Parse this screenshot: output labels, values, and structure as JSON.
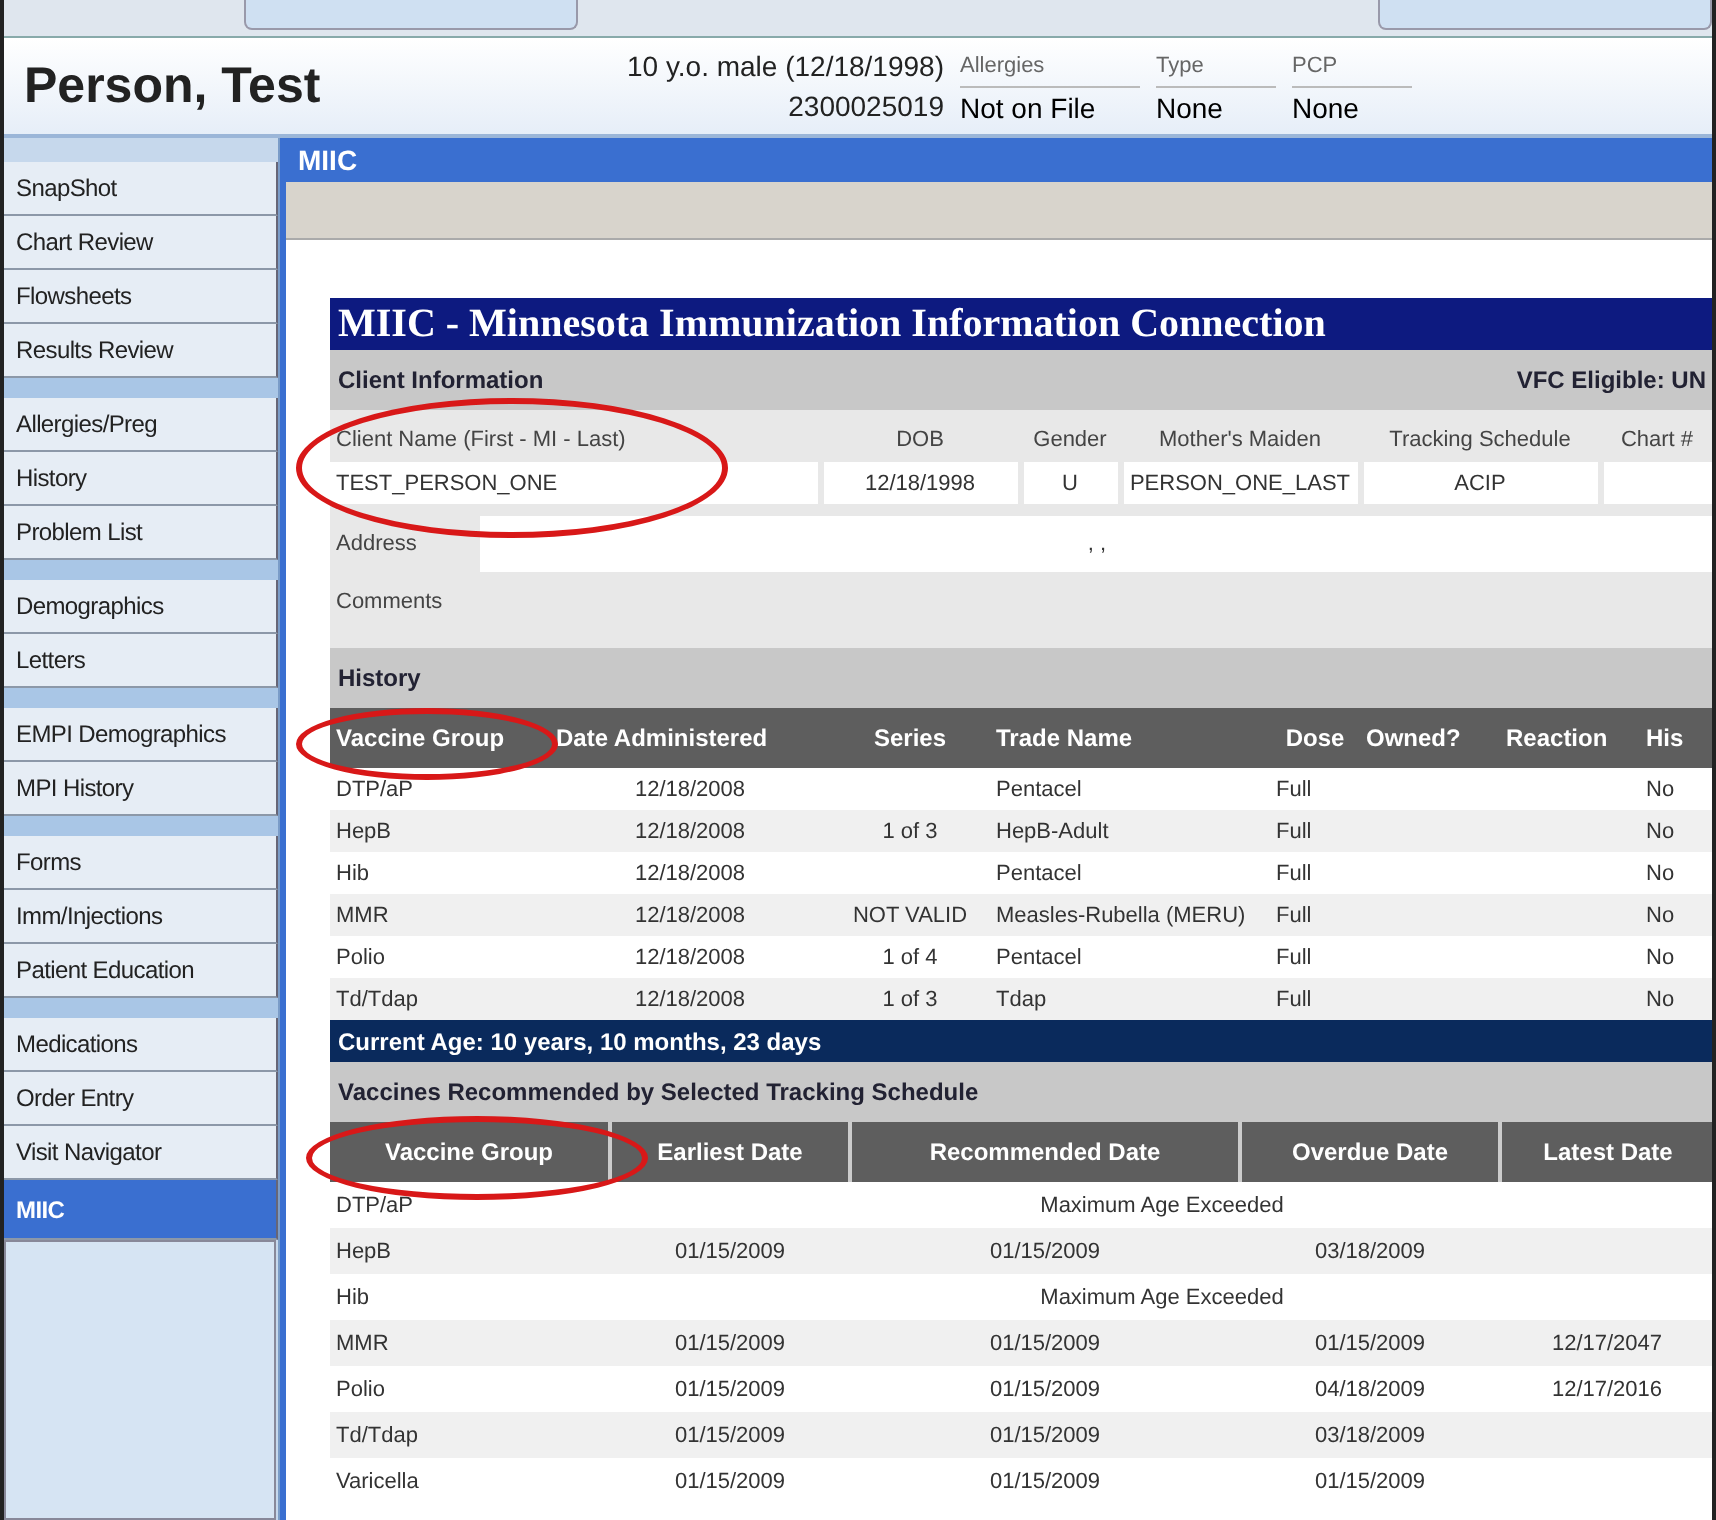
{
  "patient": {
    "name": "Person, Test",
    "age_sex_dob": "10 y.o. male (12/18/1998)",
    "mrn": "2300025019",
    "fields": [
      {
        "label": "Allergies",
        "value": "Not on File"
      },
      {
        "label": "Type",
        "value": "None"
      },
      {
        "label": "PCP",
        "value": "None"
      }
    ]
  },
  "sidebar": {
    "groups": [
      [
        {
          "label": "SnapShot",
          "selected": false
        },
        {
          "label": "Chart Review",
          "selected": false
        },
        {
          "label": "Flowsheets",
          "selected": false
        },
        {
          "label": "Results Review",
          "selected": false
        }
      ],
      [
        {
          "label": "Allergies/Preg",
          "selected": false
        },
        {
          "label": "History",
          "selected": false
        },
        {
          "label": "Problem List",
          "selected": false
        }
      ],
      [
        {
          "label": "Demographics",
          "selected": false
        },
        {
          "label": "Letters",
          "selected": false
        }
      ],
      [
        {
          "label": "EMPI Demographics",
          "selected": false
        },
        {
          "label": "MPI History",
          "selected": false
        }
      ],
      [
        {
          "label": "Forms",
          "selected": false
        },
        {
          "label": "Imm/Injections",
          "selected": false
        },
        {
          "label": "Patient Education",
          "selected": false
        }
      ],
      [
        {
          "label": "Medications",
          "selected": false
        },
        {
          "label": "Order Entry",
          "selected": false
        },
        {
          "label": "Visit Navigator",
          "selected": false
        },
        {
          "label": "MIIC",
          "selected": true
        }
      ]
    ]
  },
  "activity_title": "MIIC",
  "miic": {
    "title": "MIIC - Minnesota Immunization Information Connection",
    "client_info": {
      "heading": "Client Information",
      "vfc": "VFC Eligible: UN",
      "columns": [
        "Client Name (First - MI - Last)",
        "DOB",
        "Gender",
        "Mother's Maiden",
        "Tracking Schedule",
        "Chart #"
      ],
      "values": [
        "TEST_PERSON_ONE",
        "12/18/1998",
        "U",
        "PERSON_ONE_LAST",
        "ACIP"
      ],
      "address_label": "Address",
      "address_value": ", ,",
      "comments_label": "Comments"
    },
    "history": {
      "heading": "History",
      "columns": [
        "Vaccine Group",
        "Date Administered",
        "Series",
        "Trade Name",
        "Dose",
        "Owned?",
        "Reaction",
        "His"
      ],
      "rows": [
        {
          "group": "DTP/aP",
          "date": "12/18/2008",
          "trade": "Pentacel",
          "dose": "Full",
          "history": "No"
        },
        {
          "group": "HepB",
          "date": "12/18/2008",
          "series": "1 of 3",
          "trade": "HepB-Adult",
          "dose": "Full",
          "history": "No"
        },
        {
          "group": "Hib",
          "date": "12/18/2008",
          "trade": "Pentacel",
          "dose": "Full",
          "history": "No"
        },
        {
          "group": "MMR",
          "date": "12/18/2008",
          "series": "NOT VALID",
          "trade": "Measles-Rubella (MERU)",
          "dose": "Full",
          "history": "No"
        },
        {
          "group": "Polio",
          "date": "12/18/2008",
          "series": "1 of 4",
          "trade": "Pentacel",
          "dose": "Full",
          "history": "No"
        },
        {
          "group": "Td/Tdap",
          "date": "12/18/2008",
          "series": "1 of 3",
          "trade": "Tdap",
          "dose": "Full",
          "history": "No"
        }
      ]
    },
    "current_age": "Current Age: 10 years, 10 months, 23 days",
    "recommended": {
      "heading": "Vaccines Recommended by Selected Tracking Schedule",
      "columns": [
        "Vaccine Group",
        "Earliest Date",
        "Recommended Date",
        "Overdue Date",
        "Latest Date"
      ],
      "rows": [
        {
          "kind": "note",
          "group": "DTP/aP",
          "note": "Maximum Age Exceeded"
        },
        {
          "kind": "dates",
          "group": "HepB",
          "dates": [
            "01/15/2009",
            "01/15/2009",
            "03/18/2009"
          ]
        },
        {
          "kind": "note",
          "group": "Hib",
          "note": "Maximum Age Exceeded"
        },
        {
          "kind": "dates",
          "group": "MMR",
          "dates": [
            "01/15/2009",
            "01/15/2009",
            "01/15/2009",
            "12/17/2047"
          ]
        },
        {
          "kind": "dates",
          "group": "Polio",
          "dates": [
            "01/15/2009",
            "01/15/2009",
            "04/18/2009",
            "12/17/2016"
          ]
        },
        {
          "kind": "dates",
          "group": "Td/Tdap",
          "dates": [
            "01/15/2009",
            "01/15/2009",
            "03/18/2009"
          ]
        },
        {
          "kind": "dates",
          "group": "Varicella",
          "dates": [
            "01/15/2009",
            "01/15/2009",
            "01/15/2009"
          ]
        }
      ]
    }
  }
}
